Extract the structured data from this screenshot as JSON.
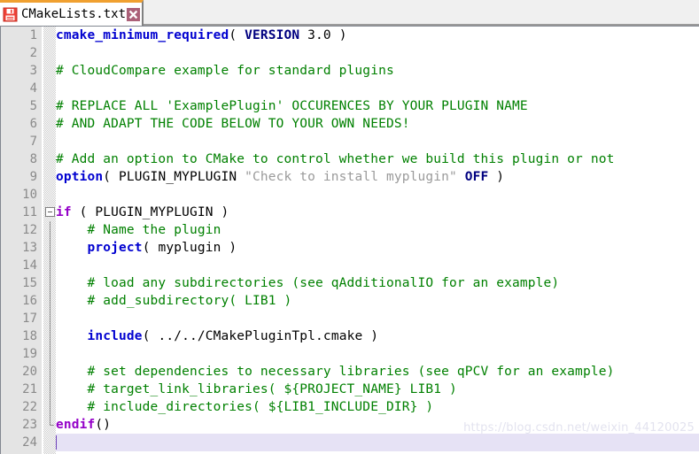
{
  "window": {
    "accent_orange": "#f0a030",
    "tab_close_bg": "#ab6078"
  },
  "tab": {
    "title": "CMakeLists.txt",
    "save_icon": "floppy-disk-icon",
    "close_icon": "close-icon",
    "close_label": "✕"
  },
  "watermark": {
    "text": "https://blog.csdn.net/weixin_44120025"
  },
  "editor": {
    "language": "cmake",
    "total_lines": 24,
    "current_line": 24,
    "colors": {
      "command": "#0000d0",
      "control": "#9400c8",
      "constant": "#000080",
      "string": "#9a9a9a",
      "comment": "#008000",
      "plain": "#000000",
      "current_line_bg": "#e6e2f5",
      "gutter_bg": "#e4e4e4",
      "line_number": "#8a8a8a"
    },
    "lines": [
      {
        "n": "1",
        "fold": "open",
        "tokens": [
          {
            "t": "cmake_minimum_required",
            "c": "k-cmd"
          },
          {
            "t": "( ",
            "c": "k-plain"
          },
          {
            "t": "VERSION",
            "c": "k-const"
          },
          {
            "t": " 3.0 )",
            "c": "k-plain"
          }
        ]
      },
      {
        "n": "2",
        "fold": "none",
        "tokens": []
      },
      {
        "n": "3",
        "fold": "none",
        "tokens": [
          {
            "t": "# CloudCompare example for standard plugins",
            "c": "k-com"
          }
        ]
      },
      {
        "n": "4",
        "fold": "none",
        "tokens": []
      },
      {
        "n": "5",
        "fold": "none",
        "tokens": [
          {
            "t": "# REPLACE ALL 'ExamplePlugin' OCCURENCES BY YOUR PLUGIN NAME",
            "c": "k-com"
          }
        ]
      },
      {
        "n": "6",
        "fold": "none",
        "tokens": [
          {
            "t": "# AND ADAPT THE CODE BELOW TO YOUR OWN NEEDS!",
            "c": "k-com"
          }
        ]
      },
      {
        "n": "7",
        "fold": "none",
        "tokens": []
      },
      {
        "n": "8",
        "fold": "none",
        "tokens": [
          {
            "t": "# Add an option to CMake to control whether we build this plugin or not",
            "c": "k-com"
          }
        ]
      },
      {
        "n": "9",
        "fold": "none",
        "tokens": [
          {
            "t": "option",
            "c": "k-cmd"
          },
          {
            "t": "( PLUGIN_MYPLUGIN ",
            "c": "k-plain"
          },
          {
            "t": "\"Check to install myplugin\"",
            "c": "k-str"
          },
          {
            "t": " ",
            "c": "k-plain"
          },
          {
            "t": "OFF",
            "c": "k-const"
          },
          {
            "t": " )",
            "c": "k-plain"
          }
        ]
      },
      {
        "n": "10",
        "fold": "none",
        "tokens": []
      },
      {
        "n": "11",
        "fold": "box",
        "tokens": [
          {
            "t": "if",
            "c": "k-ctrl"
          },
          {
            "t": " ( PLUGIN_MYPLUGIN )",
            "c": "k-plain"
          }
        ]
      },
      {
        "n": "12",
        "fold": "line",
        "tokens": [
          {
            "t": "    # Name the plugin",
            "c": "k-com"
          }
        ]
      },
      {
        "n": "13",
        "fold": "line",
        "tokens": [
          {
            "t": "    ",
            "c": "k-plain"
          },
          {
            "t": "project",
            "c": "k-cmd"
          },
          {
            "t": "( myplugin )",
            "c": "k-plain"
          }
        ]
      },
      {
        "n": "14",
        "fold": "line",
        "tokens": []
      },
      {
        "n": "15",
        "fold": "line",
        "tokens": [
          {
            "t": "    # load any subdirectories (see qAdditionalIO for an example)",
            "c": "k-com"
          }
        ]
      },
      {
        "n": "16",
        "fold": "line",
        "tokens": [
          {
            "t": "    # add_subdirectory( LIB1 )",
            "c": "k-com"
          }
        ]
      },
      {
        "n": "17",
        "fold": "line",
        "tokens": []
      },
      {
        "n": "18",
        "fold": "line",
        "tokens": [
          {
            "t": "    ",
            "c": "k-plain"
          },
          {
            "t": "include",
            "c": "k-cmd"
          },
          {
            "t": "( ../../CMakePluginTpl.cmake )",
            "c": "k-plain"
          }
        ]
      },
      {
        "n": "19",
        "fold": "line",
        "tokens": []
      },
      {
        "n": "20",
        "fold": "line",
        "tokens": [
          {
            "t": "    # set dependencies to necessary libraries (see qPCV for an example)",
            "c": "k-com"
          }
        ]
      },
      {
        "n": "21",
        "fold": "line",
        "tokens": [
          {
            "t": "    # target_link_libraries( ${PROJECT_NAME} LIB1 )",
            "c": "k-com"
          }
        ]
      },
      {
        "n": "22",
        "fold": "line",
        "tokens": [
          {
            "t": "    # include_directories( ${LIB1_INCLUDE_DIR} )",
            "c": "k-com"
          }
        ]
      },
      {
        "n": "23",
        "fold": "end",
        "tokens": [
          {
            "t": "endif",
            "c": "k-ctrl"
          },
          {
            "t": "()",
            "c": "k-plain"
          }
        ]
      },
      {
        "n": "24",
        "fold": "none",
        "current": true,
        "caret": true,
        "tokens": []
      }
    ]
  }
}
